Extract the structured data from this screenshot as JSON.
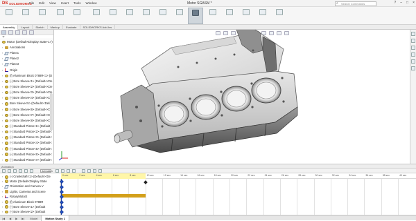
{
  "app": {
    "logo_text": "SOLIDWORKS",
    "menus": [
      "File",
      "Edit",
      "View",
      "Insert",
      "Tools",
      "Window"
    ],
    "doc_title": "Motor SGASM *",
    "search_placeholder": "Search Commands"
  },
  "command_tabs": [
    "Assembly",
    "Layout",
    "Sketch",
    "Markup",
    "Evaluate",
    "SOLIDWORKS Add-Ins"
  ],
  "feature_tree": {
    "root": "Motor  (Default<Display State-1>)",
    "items": [
      {
        "label": "Annotations",
        "icon": "annotations-icon"
      },
      {
        "label": "Plane1",
        "icon": "plane-icon"
      },
      {
        "label": "Plane2",
        "icon": "plane-icon"
      },
      {
        "label": "Plane3",
        "icon": "plane-icon"
      },
      {
        "label": "Origin",
        "icon": "origin-icon"
      },
      {
        "label": "(f) Aluminum Block 0788R<1> (D",
        "icon": "part-icon"
      },
      {
        "label": "(-) Bore Sleeve<1> (Default<<De",
        "icon": "part-icon"
      },
      {
        "label": "(-) Bore Sleeve<2> (Default<<De",
        "icon": "part-icon"
      },
      {
        "label": "(-) Bore Sleeve<3> (Default<<De",
        "icon": "part-icon"
      },
      {
        "label": "(-) Bore Sleeve<4> (Default<<De",
        "icon": "part-icon"
      },
      {
        "label": "Bore Sleeve<5> (Default<<Defa",
        "icon": "part-icon"
      },
      {
        "label": "(-) Bore Sleeve<6> (Default<<De",
        "icon": "part-icon"
      },
      {
        "label": "(-) Bore Sleeve<7> (Default<<De",
        "icon": "part-icon"
      },
      {
        "label": "(-) Bore Sleeve<8> (Default<<De",
        "icon": "part-icon"
      },
      {
        "label": "(-) Standard Piston<1> (Default<",
        "icon": "part-icon"
      },
      {
        "label": "(-) Standard Piston<2> (Default<",
        "icon": "part-icon"
      },
      {
        "label": "(-) Standard Piston<3> (Default<",
        "icon": "part-icon"
      },
      {
        "label": "(-) Standard Piston<4> (Default<",
        "icon": "part-icon"
      },
      {
        "label": "(-) Standard Piston<5> (Default<",
        "icon": "part-icon"
      },
      {
        "label": "(-) Standard Piston<6> (Default<",
        "icon": "part-icon"
      },
      {
        "label": "(-) Standard Piston<7> (Default<",
        "icon": "part-icon"
      },
      {
        "label": "(-) Standard Piston<8> (Default<",
        "icon": "part-icon"
      },
      {
        "label": "(-) Connecting rod<1> (Default<<",
        "icon": "part-icon"
      },
      {
        "label": "(-) Crankshaft<1> (Default<<De",
        "icon": "part-icon"
      }
    ]
  },
  "motion_study": {
    "bar_label": "Animation",
    "type_value": "Animation",
    "tree": [
      {
        "label": "Motor  (Default<Display State",
        "icon": "part-icon"
      },
      {
        "label": "Orientation and Camera V",
        "icon": "plane-icon"
      },
      {
        "label": "Lights, Cameras and Scene",
        "icon": "annotations-icon"
      },
      {
        "label": "RotaryMotor2",
        "icon": "origin-icon"
      },
      {
        "label": "(f) Aluminum Block 0788R",
        "icon": "part-icon"
      },
      {
        "label": "(-) Bore Sleeve<1> (Default",
        "icon": "part-icon"
      },
      {
        "label": "(-) Bore Sleeve<2> (Default",
        "icon": "part-icon"
      }
    ],
    "ticks": [
      "0 sec",
      "2 sec",
      "4 sec",
      "6 sec",
      "8 sec",
      "10 sec",
      "12 sec",
      "14 sec",
      "16 sec",
      "18 sec",
      "20 sec",
      "22 sec",
      "24 sec",
      "26 sec",
      "28 sec",
      "30 sec",
      "32 sec",
      "34 sec",
      "36 sec",
      "38 sec",
      "40 sec"
    ]
  },
  "bottom_tabs": [
    "Model",
    "Motion Study 1"
  ],
  "colors": {
    "brand": "#d52b1e",
    "timeline_highlight": "#fff6a8",
    "motor_bar": "#d3a01a",
    "key": "#2d5bd6"
  }
}
